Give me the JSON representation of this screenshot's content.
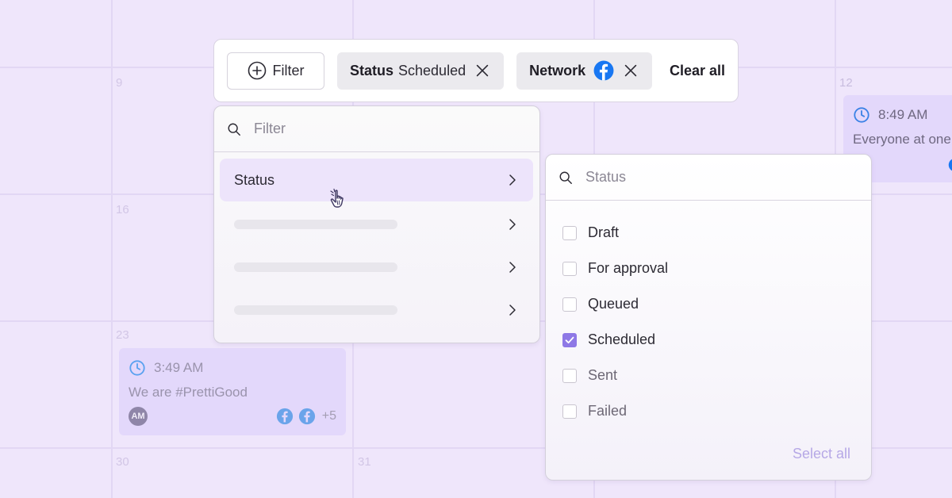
{
  "calendar": {
    "days": {
      "d9": "9",
      "d12": "12",
      "d16": "16",
      "d23": "23",
      "d30": "30",
      "d31": "31"
    },
    "events": [
      {
        "time": "3:49 AM",
        "title": "We are #PrettiGood",
        "avatar": "AM",
        "extra_networks": "+5"
      },
      {
        "time": "8:49 AM",
        "title": "Everyone at one"
      }
    ]
  },
  "filter_bar": {
    "filter_button": "Filter",
    "status_chip": {
      "label": "Status",
      "value": "Scheduled"
    },
    "network_chip": {
      "label": "Network",
      "icon": "facebook-icon"
    },
    "clear_all": "Clear all"
  },
  "filter_menu": {
    "search_placeholder": "Filter",
    "items": [
      {
        "label": "Status",
        "active": true
      }
    ]
  },
  "status_menu": {
    "search_placeholder": "Status",
    "options": [
      {
        "label": "Draft",
        "checked": false
      },
      {
        "label": "For approval",
        "checked": false
      },
      {
        "label": "Queued",
        "checked": false
      },
      {
        "label": "Scheduled",
        "checked": true
      },
      {
        "label": "Sent",
        "checked": false
      },
      {
        "label": "Failed",
        "checked": false
      }
    ],
    "select_all": "Select all"
  },
  "colors": {
    "background": "#efe6fb",
    "accent": "#8e78e6",
    "facebook": "#1877f2",
    "event_card": "#e3d8fb"
  }
}
